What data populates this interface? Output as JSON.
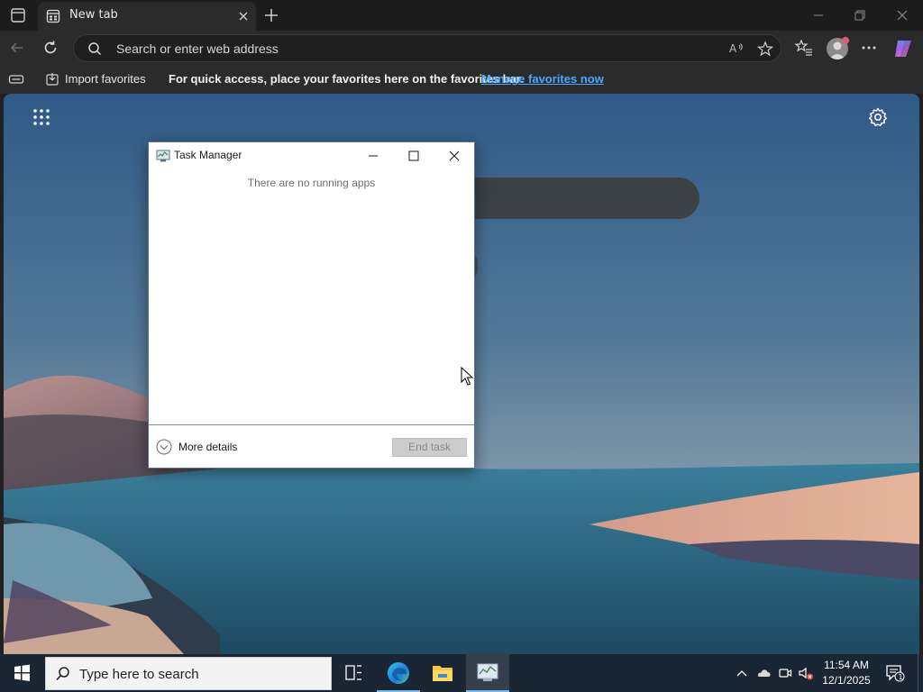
{
  "browser": {
    "tab": {
      "title": "New tab"
    },
    "address_bar": {
      "placeholder": "Search or enter web address"
    },
    "favorites_bar": {
      "import_label": "Import favorites",
      "quick_access_text": "For quick access, place your favorites here on the favorites bar.",
      "manage_link": "Manage favorites now"
    }
  },
  "task_manager": {
    "title": "Task Manager",
    "empty_message": "There are no running apps",
    "more_details_label": "More details",
    "end_task_label": "End task"
  },
  "taskbar": {
    "search_placeholder": "Type here to search",
    "clock": {
      "time": "11:54 AM",
      "date": "12/1/2025"
    },
    "notification_count": "1"
  }
}
